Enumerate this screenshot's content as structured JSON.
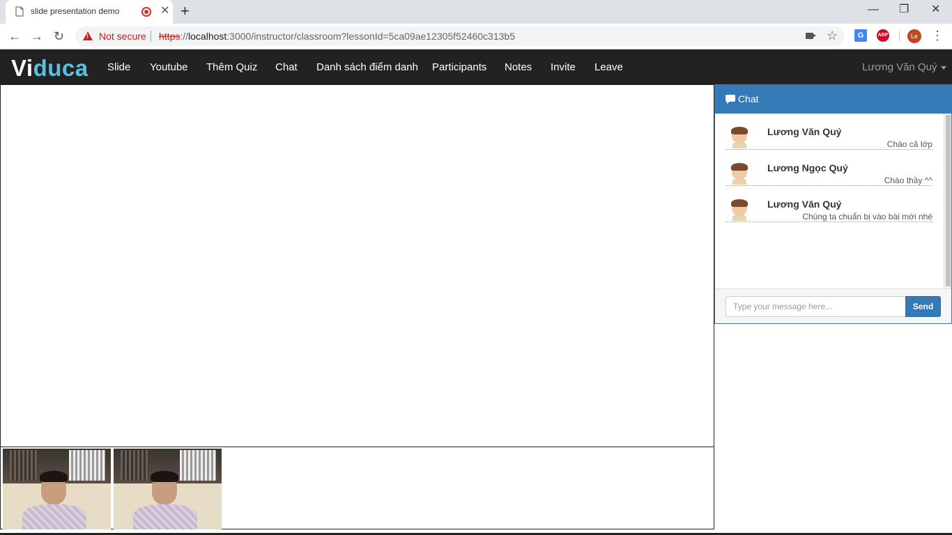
{
  "browser": {
    "tab_title": "slide presentation demo",
    "tab_close": "✕",
    "new_tab": "+",
    "window_controls": {
      "minimize": "—",
      "maximize": "❐",
      "close": "✕"
    },
    "nav": {
      "back": "←",
      "forward": "→",
      "reload": "↻"
    },
    "security_label": "Not secure",
    "url_scheme": "https",
    "url_sep": "://",
    "url_host": "localhost",
    "url_rest": ":3000/instructor/classroom?lessonId=5ca09ae12305f52460c313b5",
    "star": "☆",
    "extensions": {
      "translate": "G",
      "adblock": "ABP"
    },
    "profile_initials": "Le",
    "menu": "⋮"
  },
  "app": {
    "brand_first": "Vi",
    "brand_second": "duca",
    "nav_items": [
      "Slide",
      "Youtube",
      "Thêm Quiz",
      "Chat",
      "Danh sách điểm danh",
      "Participants",
      "Notes",
      "Invite",
      "Leave"
    ],
    "user_name": "Lương Văn Quý"
  },
  "chat": {
    "title": "Chat",
    "messages": [
      {
        "sender": "Lương Văn Quý",
        "text": "Chào cả lớp"
      },
      {
        "sender": "Lương Ngọc Quý",
        "text": "Chào thầy ^^"
      },
      {
        "sender": "Lương Văn Quý",
        "text": "Chúng ta chuẩn bị vào bài mới nhé"
      }
    ],
    "input_placeholder": "Type your message here...",
    "send_label": "Send"
  },
  "colors": {
    "navbar_bg": "#222222",
    "brand_accent": "#5bc0de",
    "chat_primary": "#337ab7",
    "not_secure": "#c5221f"
  },
  "icons": [
    "page-icon",
    "recording-icon",
    "warning-icon",
    "camera-icon",
    "star-icon",
    "chat-icon",
    "avatar-icon",
    "caret-down-icon"
  ]
}
